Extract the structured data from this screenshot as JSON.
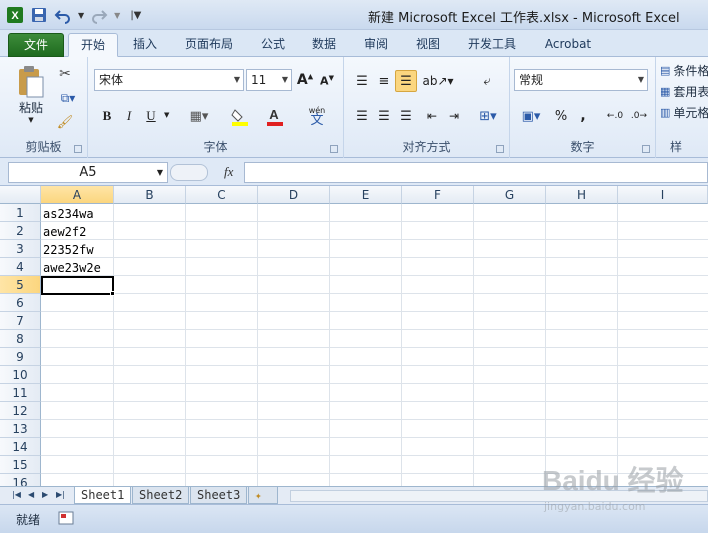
{
  "window": {
    "title": "新建 Microsoft Excel 工作表.xlsx  -  Microsoft Excel"
  },
  "ribbon_tabs": [
    "文件",
    "开始",
    "插入",
    "页面布局",
    "公式",
    "数据",
    "审阅",
    "视图",
    "开发工具",
    "Acrobat"
  ],
  "active_tab": "开始",
  "ribbon": {
    "clipboard": {
      "label": "剪贴板",
      "paste": "粘贴"
    },
    "font": {
      "label": "字体",
      "name": "宋体",
      "size": "11",
      "bold": "B",
      "italic": "I",
      "underline": "U",
      "phonetic": "wén"
    },
    "alignment": {
      "label": "对齐方式"
    },
    "number": {
      "label": "数字",
      "format": "常规",
      "percent": "%"
    },
    "styles": {
      "cond_format": "条件格",
      "table_format": "套用表",
      "cell_styles": "单元格",
      "label": "样"
    }
  },
  "formula_bar": {
    "name_box": "A5",
    "fx": "fx",
    "content": ""
  },
  "columns": [
    "A",
    "B",
    "C",
    "D",
    "E",
    "F",
    "G",
    "H",
    "I"
  ],
  "rows": [
    "1",
    "2",
    "3",
    "4",
    "5",
    "6",
    "7",
    "8",
    "9",
    "10",
    "11",
    "12",
    "13",
    "14",
    "15",
    "16"
  ],
  "cells": [
    "as234wa",
    "aew2f2",
    "22352fw",
    "awe23w2e"
  ],
  "selected_cell": "A5",
  "sheets": [
    "Sheet1",
    "Sheet2",
    "Sheet3"
  ],
  "active_sheet": "Sheet1",
  "status": {
    "text": "就绪"
  },
  "watermark": {
    "brand": "Baidu 经验",
    "url": "jingyan.baidu.com"
  },
  "colors": {
    "file_tab": "#2a7a2a",
    "selection_header": "#fbd67f",
    "ribbon_bg": "#dfe9f6"
  }
}
